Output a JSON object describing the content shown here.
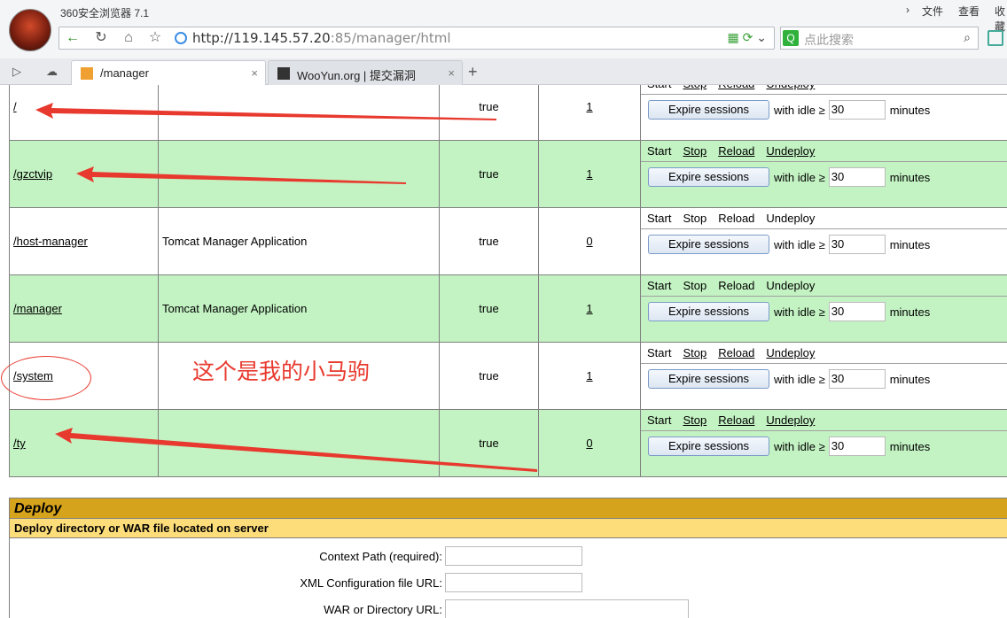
{
  "browser": {
    "app_title": "360安全浏览器 7.1",
    "menu": [
      "文件",
      "查看",
      "收藏"
    ],
    "url_host": "http://119.145.57.20",
    "url_rest": ":85/manager/html",
    "search_placeholder": "点此搜索",
    "tabs": [
      {
        "label": "/manager",
        "active": true
      },
      {
        "label": "WooYun.org | 提交漏洞",
        "active": false
      }
    ],
    "new_tab": "+"
  },
  "commands": {
    "start": "Start",
    "stop": "Stop",
    "reload": "Reload",
    "undeploy": "Undeploy",
    "expire_button": "Expire sessions",
    "with_idle": "with idle ≥",
    "minutes": "minutes"
  },
  "applications": [
    {
      "path": "/",
      "display_name": "",
      "running": "true",
      "sessions": "1",
      "idle": "30"
    },
    {
      "path": "/gzctvip",
      "display_name": "",
      "running": "true",
      "sessions": "1",
      "idle": "30"
    },
    {
      "path": "/host-manager",
      "display_name": "Tomcat Manager Application",
      "running": "true",
      "sessions": "0",
      "idle": "30"
    },
    {
      "path": "/manager",
      "display_name": "Tomcat Manager Application",
      "running": "true",
      "sessions": "1",
      "idle": "30"
    },
    {
      "path": "/system",
      "display_name": "",
      "running": "true",
      "sessions": "1",
      "idle": "30"
    },
    {
      "path": "/ty",
      "display_name": "",
      "running": "true",
      "sessions": "0",
      "idle": "30"
    }
  ],
  "annotation": {
    "text": "这个是我的小马驹",
    "color": "#e8392e"
  },
  "deploy": {
    "title": "Deploy",
    "subtitle": "Deploy directory or WAR file located on server",
    "fields": [
      {
        "label": "Context Path (required):",
        "value": ""
      },
      {
        "label": "XML Configuration file URL:",
        "value": ""
      },
      {
        "label": "WAR or Directory URL:",
        "value": ""
      }
    ]
  },
  "colors": {
    "row_even": "#c3f3c3",
    "deploy_header": "#d6a31c",
    "deploy_subheader": "#fddd7a"
  }
}
